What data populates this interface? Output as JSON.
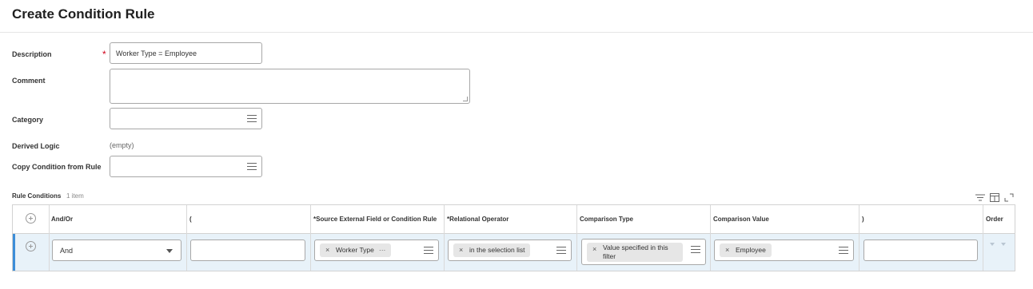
{
  "page": {
    "title": "Create Condition Rule"
  },
  "form": {
    "description": {
      "label": "Description",
      "required_mark": "*",
      "value": "Worker Type = Employee"
    },
    "comment": {
      "label": "Comment",
      "value": ""
    },
    "category": {
      "label": "Category",
      "value": ""
    },
    "derived_logic": {
      "label": "Derived Logic",
      "value": "(empty)"
    },
    "copy_condition": {
      "label": "Copy Condition from Rule",
      "value": ""
    }
  },
  "rule_conditions": {
    "label": "Rule Conditions",
    "count": "1 item",
    "columns": [
      "And/Or",
      "(",
      "*Source External Field or Condition Rule",
      "*Relational Operator",
      "Comparison Type",
      "Comparison Value",
      ")",
      "Order"
    ],
    "rows": [
      {
        "and_or": "And",
        "open_paren": "",
        "source_field": "Worker Type",
        "source_field_more": "···",
        "relational_operator": "in the selection list",
        "comparison_type": "Value specified in this filter",
        "comparison_value": "Employee",
        "close_paren": ""
      }
    ]
  },
  "icons": {
    "remove": "×",
    "toolbar": [
      "filter-icon",
      "columns-icon",
      "expand-icon"
    ]
  },
  "colors": {
    "accent": "#3c8dd8",
    "required": "#d0021b",
    "row_highlight": "#e8f2f9"
  }
}
